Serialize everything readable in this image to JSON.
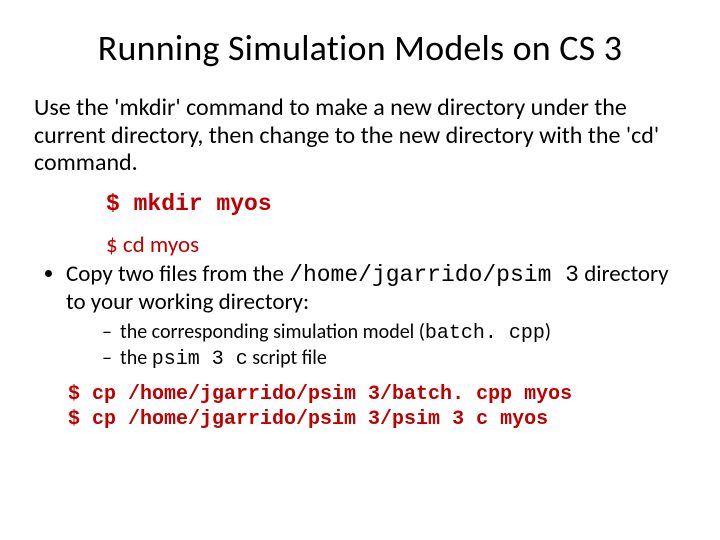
{
  "title": "Running Simulation Models on CS 3",
  "intro": "Use the 'mkdir' command to make a new directory under the current directory, then change to the new directory with the 'cd' command.",
  "cmd_mkdir": "$ mkdir myos",
  "cmd_cd": "$ cd myos",
  "bullet_prefix": "Copy two files from the ",
  "bullet_path": "/home/jgarrido/psim 3",
  "bullet_suffix": " directory to your working directory:",
  "sub1_prefix": "the corresponding simulation model (",
  "sub1_mono": "batch. cpp",
  "sub1_suffix": ")",
  "sub2_prefix": "the ",
  "sub2_mono": "psim 3 c",
  "sub2_suffix": " script file",
  "cp1": "$ cp /home/jgarrido/psim 3/batch. cpp myos",
  "cp2": "$ cp /home/jgarrido/psim 3/psim 3 c myos"
}
